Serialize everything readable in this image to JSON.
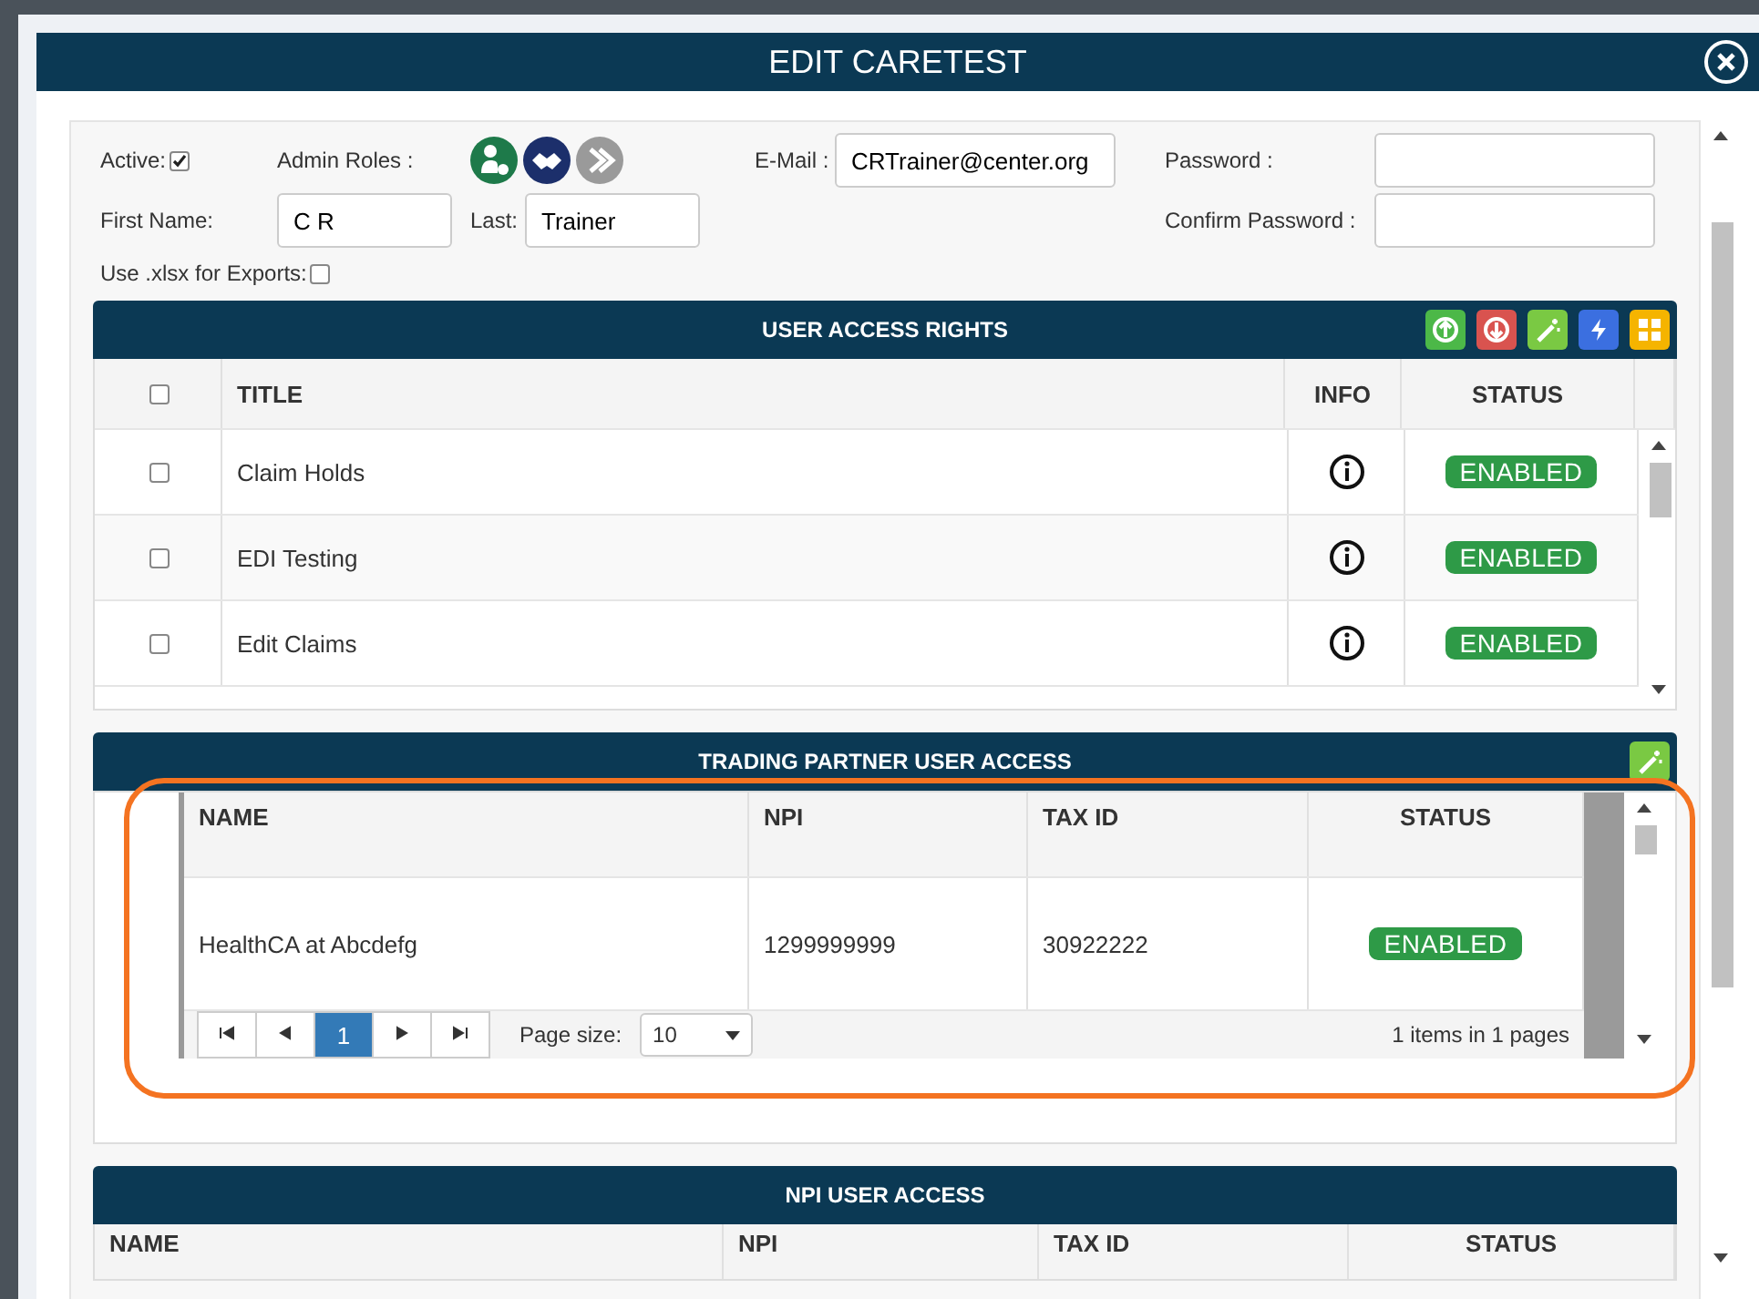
{
  "dialog": {
    "title": "EDIT CARETEST"
  },
  "form": {
    "active": {
      "label": "Active:",
      "checked": true
    },
    "admin_roles": {
      "label": "Admin Roles :"
    },
    "email": {
      "label": "E-Mail :",
      "value": "CRTrainer@center.org"
    },
    "password": {
      "label": "Password :"
    },
    "first_name": {
      "label": "First Name:",
      "value": "C R"
    },
    "last_name": {
      "label": "Last:",
      "value": "Trainer"
    },
    "confirm_password": {
      "label": "Confirm Password :"
    },
    "xlsx": {
      "label": "Use .xlsx for Exports:",
      "checked": false
    }
  },
  "user_access_rights": {
    "title": "USER ACCESS RIGHTS",
    "select_all_checked": false,
    "columns": [
      "TITLE",
      "INFO",
      "STATUS"
    ],
    "rows": [
      {
        "title": "Claim Holds",
        "checked": false,
        "status": "ENABLED"
      },
      {
        "title": "EDI Testing",
        "checked": false,
        "status": "ENABLED"
      },
      {
        "title": "Edit Claims",
        "checked": false,
        "status": "ENABLED"
      }
    ]
  },
  "trading_partner_access": {
    "title": "TRADING PARTNER USER ACCESS",
    "columns": [
      "NAME",
      "NPI",
      "TAX ID",
      "STATUS"
    ],
    "rows": [
      {
        "name": "HealthCA at Abcdefg",
        "npi": "1299999999",
        "tax_id": "30922222",
        "status": "ENABLED"
      }
    ],
    "pager": {
      "pages": [
        {
          "label": "1",
          "selected": true
        }
      ],
      "page_size_label": "Page size:",
      "page_size": "10",
      "summary": "1 items in 1 pages"
    }
  },
  "npi_access": {
    "title": "NPI USER ACCESS",
    "columns": [
      "NAME",
      "NPI",
      "TAX ID",
      "STATUS"
    ]
  }
}
